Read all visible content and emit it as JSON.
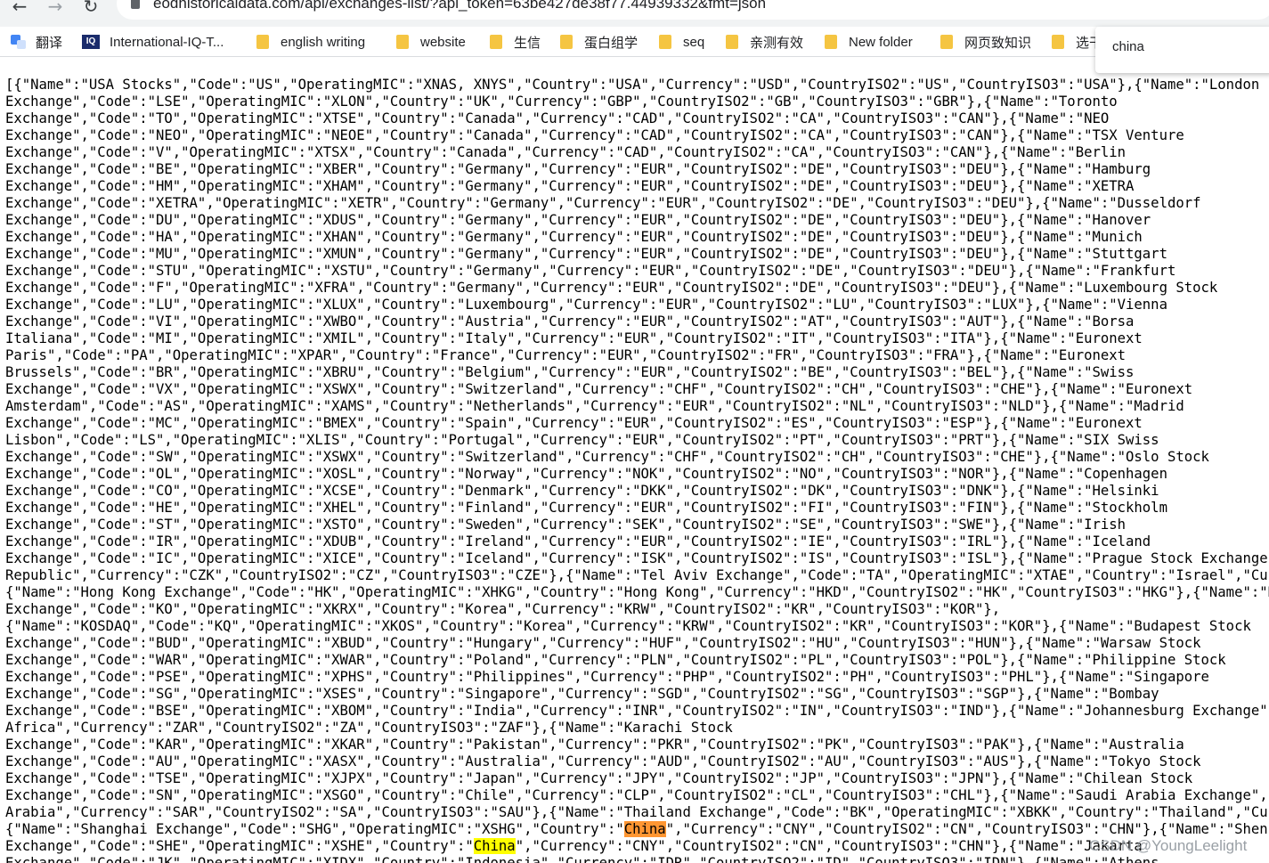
{
  "browser": {
    "url": "eodhistoricaldata.com/api/exchanges-list/?api_token=63be427de38f77.44939332&fmt=json",
    "nav_icons": [
      "back-arrow-icon",
      "forward-arrow-icon",
      "reload-icon",
      "lock-icon"
    ]
  },
  "bookmarks": [
    {
      "label": "翻译",
      "icon": "google-translate-icon"
    },
    {
      "label": "International-IQ-T...",
      "icon": "iq-icon"
    },
    {
      "label": "english writing",
      "icon": "folder-icon"
    },
    {
      "label": "website",
      "icon": "folder-icon"
    },
    {
      "label": "生信",
      "icon": "folder-icon"
    },
    {
      "label": "蛋白组学",
      "icon": "folder-icon"
    },
    {
      "label": "seq",
      "icon": "folder-icon"
    },
    {
      "label": "亲测有效",
      "icon": "folder-icon"
    },
    {
      "label": "New folder",
      "icon": "folder-icon"
    },
    {
      "label": "网页致知识",
      "icon": "folder-icon"
    },
    {
      "label": "选干",
      "icon": "folder-icon"
    }
  ],
  "find_bar": {
    "query": "china"
  },
  "json_lines": [
    "[{\"Name\":\"USA Stocks\",\"Code\":\"US\",\"OperatingMIC\":\"XNAS, XNYS\",\"Country\":\"USA\",\"Currency\":\"USD\",\"CountryISO2\":\"US\",\"CountryISO3\":\"USA\"},{\"Name\":\"London",
    "Exchange\",\"Code\":\"LSE\",\"OperatingMIC\":\"XLON\",\"Country\":\"UK\",\"Currency\":\"GBP\",\"CountryISO2\":\"GB\",\"CountryISO3\":\"GBR\"},{\"Name\":\"Toronto",
    "Exchange\",\"Code\":\"TO\",\"OperatingMIC\":\"XTSE\",\"Country\":\"Canada\",\"Currency\":\"CAD\",\"CountryISO2\":\"CA\",\"CountryISO3\":\"CAN\"},{\"Name\":\"NEO",
    "Exchange\",\"Code\":\"NEO\",\"OperatingMIC\":\"NEOE\",\"Country\":\"Canada\",\"Currency\":\"CAD\",\"CountryISO2\":\"CA\",\"CountryISO3\":\"CAN\"},{\"Name\":\"TSX Venture",
    "Exchange\",\"Code\":\"V\",\"OperatingMIC\":\"XTSX\",\"Country\":\"Canada\",\"Currency\":\"CAD\",\"CountryISO2\":\"CA\",\"CountryISO3\":\"CAN\"},{\"Name\":\"Berlin",
    "Exchange\",\"Code\":\"BE\",\"OperatingMIC\":\"XBER\",\"Country\":\"Germany\",\"Currency\":\"EUR\",\"CountryISO2\":\"DE\",\"CountryISO3\":\"DEU\"},{\"Name\":\"Hamburg",
    "Exchange\",\"Code\":\"HM\",\"OperatingMIC\":\"XHAM\",\"Country\":\"Germany\",\"Currency\":\"EUR\",\"CountryISO2\":\"DE\",\"CountryISO3\":\"DEU\"},{\"Name\":\"XETRA",
    "Exchange\",\"Code\":\"XETRA\",\"OperatingMIC\":\"XETR\",\"Country\":\"Germany\",\"Currency\":\"EUR\",\"CountryISO2\":\"DE\",\"CountryISO3\":\"DEU\"},{\"Name\":\"Dusseldorf",
    "Exchange\",\"Code\":\"DU\",\"OperatingMIC\":\"XDUS\",\"Country\":\"Germany\",\"Currency\":\"EUR\",\"CountryISO2\":\"DE\",\"CountryISO3\":\"DEU\"},{\"Name\":\"Hanover",
    "Exchange\",\"Code\":\"HA\",\"OperatingMIC\":\"XHAN\",\"Country\":\"Germany\",\"Currency\":\"EUR\",\"CountryISO2\":\"DE\",\"CountryISO3\":\"DEU\"},{\"Name\":\"Munich",
    "Exchange\",\"Code\":\"MU\",\"OperatingMIC\":\"XMUN\",\"Country\":\"Germany\",\"Currency\":\"EUR\",\"CountryISO2\":\"DE\",\"CountryISO3\":\"DEU\"},{\"Name\":\"Stuttgart",
    "Exchange\",\"Code\":\"STU\",\"OperatingMIC\":\"XSTU\",\"Country\":\"Germany\",\"Currency\":\"EUR\",\"CountryISO2\":\"DE\",\"CountryISO3\":\"DEU\"},{\"Name\":\"Frankfurt",
    "Exchange\",\"Code\":\"F\",\"OperatingMIC\":\"XFRA\",\"Country\":\"Germany\",\"Currency\":\"EUR\",\"CountryISO2\":\"DE\",\"CountryISO3\":\"DEU\"},{\"Name\":\"Luxembourg Stock",
    "Exchange\",\"Code\":\"LU\",\"OperatingMIC\":\"XLUX\",\"Country\":\"Luxembourg\",\"Currency\":\"EUR\",\"CountryISO2\":\"LU\",\"CountryISO3\":\"LUX\"},{\"Name\":\"Vienna",
    "Exchange\",\"Code\":\"VI\",\"OperatingMIC\":\"XWBO\",\"Country\":\"Austria\",\"Currency\":\"EUR\",\"CountryISO2\":\"AT\",\"CountryISO3\":\"AUT\"},{\"Name\":\"Borsa",
    "Italiana\",\"Code\":\"MI\",\"OperatingMIC\":\"XMIL\",\"Country\":\"Italy\",\"Currency\":\"EUR\",\"CountryISO2\":\"IT\",\"CountryISO3\":\"ITA\"},{\"Name\":\"Euronext",
    "Paris\",\"Code\":\"PA\",\"OperatingMIC\":\"XPAR\",\"Country\":\"France\",\"Currency\":\"EUR\",\"CountryISO2\":\"FR\",\"CountryISO3\":\"FRA\"},{\"Name\":\"Euronext",
    "Brussels\",\"Code\":\"BR\",\"OperatingMIC\":\"XBRU\",\"Country\":\"Belgium\",\"Currency\":\"EUR\",\"CountryISO2\":\"BE\",\"CountryISO3\":\"BEL\"},{\"Name\":\"Swiss",
    "Exchange\",\"Code\":\"VX\",\"OperatingMIC\":\"XSWX\",\"Country\":\"Switzerland\",\"Currency\":\"CHF\",\"CountryISO2\":\"CH\",\"CountryISO3\":\"CHE\"},{\"Name\":\"Euronext",
    "Amsterdam\",\"Code\":\"AS\",\"OperatingMIC\":\"XAMS\",\"Country\":\"Netherlands\",\"Currency\":\"EUR\",\"CountryISO2\":\"NL\",\"CountryISO3\":\"NLD\"},{\"Name\":\"Madrid",
    "Exchange\",\"Code\":\"MC\",\"OperatingMIC\":\"BMEX\",\"Country\":\"Spain\",\"Currency\":\"EUR\",\"CountryISO2\":\"ES\",\"CountryISO3\":\"ESP\"},{\"Name\":\"Euronext",
    "Lisbon\",\"Code\":\"LS\",\"OperatingMIC\":\"XLIS\",\"Country\":\"Portugal\",\"Currency\":\"EUR\",\"CountryISO2\":\"PT\",\"CountryISO3\":\"PRT\"},{\"Name\":\"SIX Swiss",
    "Exchange\",\"Code\":\"SW\",\"OperatingMIC\":\"XSWX\",\"Country\":\"Switzerland\",\"Currency\":\"CHF\",\"CountryISO2\":\"CH\",\"CountryISO3\":\"CHE\"},{\"Name\":\"Oslo Stock",
    "Exchange\",\"Code\":\"OL\",\"OperatingMIC\":\"XOSL\",\"Country\":\"Norway\",\"Currency\":\"NOK\",\"CountryISO2\":\"NO\",\"CountryISO3\":\"NOR\"},{\"Name\":\"Copenhagen",
    "Exchange\",\"Code\":\"CO\",\"OperatingMIC\":\"XCSE\",\"Country\":\"Denmark\",\"Currency\":\"DKK\",\"CountryISO2\":\"DK\",\"CountryISO3\":\"DNK\"},{\"Name\":\"Helsinki",
    "Exchange\",\"Code\":\"HE\",\"OperatingMIC\":\"XHEL\",\"Country\":\"Finland\",\"Currency\":\"EUR\",\"CountryISO2\":\"FI\",\"CountryISO3\":\"FIN\"},{\"Name\":\"Stockholm",
    "Exchange\",\"Code\":\"ST\",\"OperatingMIC\":\"XSTO\",\"Country\":\"Sweden\",\"Currency\":\"SEK\",\"CountryISO2\":\"SE\",\"CountryISO3\":\"SWE\"},{\"Name\":\"Irish",
    "Exchange\",\"Code\":\"IR\",\"OperatingMIC\":\"XDUB\",\"Country\":\"Ireland\",\"Currency\":\"EUR\",\"CountryISO2\":\"IE\",\"CountryISO3\":\"IRL\"},{\"Name\":\"Iceland",
    "Exchange\",\"Code\":\"IC\",\"OperatingMIC\":\"XICE\",\"Country\":\"Iceland\",\"Currency\":\"ISK\",\"CountryISO2\":\"IS\",\"CountryISO3\":\"ISL\"},{\"Name\":\"Prague Stock Exchange \",\"Code",
    "Republic\",\"Currency\":\"CZK\",\"CountryISO2\":\"CZ\",\"CountryISO3\":\"CZE\"},{\"Name\":\"Tel Aviv Exchange\",\"Code\":\"TA\",\"OperatingMIC\":\"XTAE\",\"Country\":\"Israel\",\"Currency\":",
    "{\"Name\":\"Hong Kong Exchange\",\"Code\":\"HK\",\"OperatingMIC\":\"XHKG\",\"Country\":\"Hong Kong\",\"Currency\":\"HKD\",\"CountryISO2\":\"HK\",\"CountryISO3\":\"HKG\"},{\"Name\":\"Korea St",
    "Exchange\",\"Code\":\"KO\",\"OperatingMIC\":\"XKRX\",\"Country\":\"Korea\",\"Currency\":\"KRW\",\"CountryISO2\":\"KR\",\"CountryISO3\":\"KOR\"},",
    "{\"Name\":\"KOSDAQ\",\"Code\":\"KQ\",\"OperatingMIC\":\"XKOS\",\"Country\":\"Korea\",\"Currency\":\"KRW\",\"CountryISO2\":\"KR\",\"CountryISO3\":\"KOR\"},{\"Name\":\"Budapest Stock",
    "Exchange\",\"Code\":\"BUD\",\"OperatingMIC\":\"XBUD\",\"Country\":\"Hungary\",\"Currency\":\"HUF\",\"CountryISO2\":\"HU\",\"CountryISO3\":\"HUN\"},{\"Name\":\"Warsaw Stock",
    "Exchange\",\"Code\":\"WAR\",\"OperatingMIC\":\"XWAR\",\"Country\":\"Poland\",\"Currency\":\"PLN\",\"CountryISO2\":\"PL\",\"CountryISO3\":\"POL\"},{\"Name\":\"Philippine Stock",
    "Exchange\",\"Code\":\"PSE\",\"OperatingMIC\":\"XPHS\",\"Country\":\"Philippines\",\"Currency\":\"PHP\",\"CountryISO2\":\"PH\",\"CountryISO3\":\"PHL\"},{\"Name\":\"Singapore",
    "Exchange\",\"Code\":\"SG\",\"OperatingMIC\":\"XSES\",\"Country\":\"Singapore\",\"Currency\":\"SGD\",\"CountryISO2\":\"SG\",\"CountryISO3\":\"SGP\"},{\"Name\":\"Bombay",
    "Exchange\",\"Code\":\"BSE\",\"OperatingMIC\":\"XBOM\",\"Country\":\"India\",\"Currency\":\"INR\",\"CountryISO2\":\"IN\",\"CountryISO3\":\"IND\"},{\"Name\":\"Johannesburg Exchange\",\"Code\":",
    "Africa\",\"Currency\":\"ZAR\",\"CountryISO2\":\"ZA\",\"CountryISO3\":\"ZAF\"},{\"Name\":\"Karachi Stock",
    "Exchange\",\"Code\":\"KAR\",\"OperatingMIC\":\"XKAR\",\"Country\":\"Pakistan\",\"Currency\":\"PKR\",\"CountryISO2\":\"PK\",\"CountryISO3\":\"PAK\"},{\"Name\":\"Australia",
    "Exchange\",\"Code\":\"AU\",\"OperatingMIC\":\"XASX\",\"Country\":\"Australia\",\"Currency\":\"AUD\",\"CountryISO2\":\"AU\",\"CountryISO3\":\"AUS\"},{\"Name\":\"Tokyo Stock",
    "Exchange\",\"Code\":\"TSE\",\"OperatingMIC\":\"XJPX\",\"Country\":\"Japan\",\"Currency\":\"JPY\",\"CountryISO2\":\"JP\",\"CountryISO3\":\"JPN\"},{\"Name\":\"Chilean Stock",
    "Exchange\",\"Code\":\"SN\",\"OperatingMIC\":\"XSGO\",\"Country\":\"Chile\",\"Currency\":\"CLP\",\"CountryISO2\":\"CL\",\"CountryISO3\":\"CHL\"},{\"Name\":\"Saudi Arabia Exchange\",\"Code\":\"",
    "Arabia\",\"Currency\":\"SAR\",\"CountryISO2\":\"SA\",\"CountryISO3\":\"SAU\"},{\"Name\":\"Thailand Exchange\",\"Code\":\"BK\",\"OperatingMIC\":\"XBKK\",\"Country\":\"Thailand\",\"Currency\":",
    "{\"Name\":\"Shanghai Exchange\",\"Code\":\"SHG\",\"OperatingMIC\":\"XSHG\",\"Country\":\"China\",\"Currency\":\"CNY\",\"CountryISO2\":\"CN\",\"CountryISO3\":\"CHN\"},{\"Name\":\"Shenzhen",
    "Exchange\",\"Code\":\"SHE\",\"OperatingMIC\":\"XSHE\",\"Country\":\"China\",\"Currency\":\"CNY\",\"CountryISO2\":\"CN\",\"CountryISO3\":\"CHN\"},{\"Name\":\"Jakarta",
    "Exchange\",\"Code\":\"JK\",\"OperatingMIC\":\"XIDX\",\"Country\":\"Indonesia\",\"Currency\":\"IDR\",\"CountryISO2\":\"ID\",\"CountryISO3\":\"IDN\"},{\"Name\":\"Athens"
  ],
  "highlights": [
    {
      "line": 44,
      "text": "China",
      "style": "find-active"
    },
    {
      "line": 45,
      "text": "China",
      "style": "find"
    }
  ],
  "watermark": "CSDN @YoungLeelight",
  "colors": {
    "find_match": "#ffff00",
    "find_active": "#ff9632"
  }
}
